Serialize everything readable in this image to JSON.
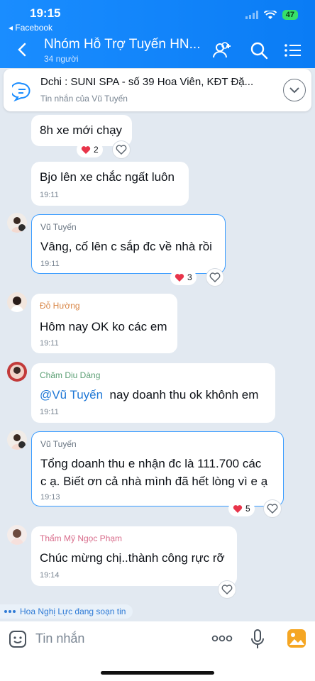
{
  "status": {
    "time": "19:15",
    "back_app": "◂ Facebook",
    "battery": "47"
  },
  "header": {
    "title": "Nhóm Hỗ Trợ Tuyến HN...",
    "members": "34 người"
  },
  "pinned": {
    "text": "Dchi : SUNI SPA - số 39 Hoa Viên, KĐT Đặ...",
    "sub": "Tin nhắn của Vũ Tuyến"
  },
  "messages": [
    {
      "text": "8h xe mới chạy",
      "reactions": "2"
    },
    {
      "text": "Bjo lên xe chắc ngất luôn",
      "time": "19:11"
    },
    {
      "sender": "Vũ Tuyến",
      "text": "Vâng, cố lên c sắp đc về nhà rồi",
      "time": "19:11",
      "reactions": "3"
    },
    {
      "sender": "Đỗ Hường",
      "text": "Hôm nay OK ko các em",
      "time": "19:11"
    },
    {
      "sender": "Chăm Dịu Dàng",
      "mention": "@Vũ Tuyến",
      "text": "nay doanh thu ok khônh em",
      "time": "19:11"
    },
    {
      "sender": "Vũ Tuyến",
      "text_line1": "Tổng doanh thu e nhận đc là 111.700 các",
      "text_line2": "c ạ. Biết ơn cả nhà mình đã hết lòng vì e ạ",
      "time": "19:13",
      "reactions": "5"
    },
    {
      "sender": "Thẩm Mỹ Ngọc Phạm",
      "text": "Chúc mừng chị..thành công rực rỡ",
      "time": "19:14"
    }
  ],
  "typing": "Hoa Nghị Lực đang soạn tin",
  "input": {
    "placeholder": "Tin nhắn"
  },
  "colors": {
    "accent": "#1a8dff",
    "mine_border": "#3a9cff",
    "heart": "#e8344a"
  },
  "icons": [
    "chevron-left-icon",
    "add-member-icon",
    "search-icon",
    "menu-icon",
    "pinned-message-icon",
    "chevron-down-icon",
    "heart-icon",
    "heart-outline-icon",
    "sticker-icon",
    "more-icon",
    "mic-icon",
    "image-icon"
  ]
}
